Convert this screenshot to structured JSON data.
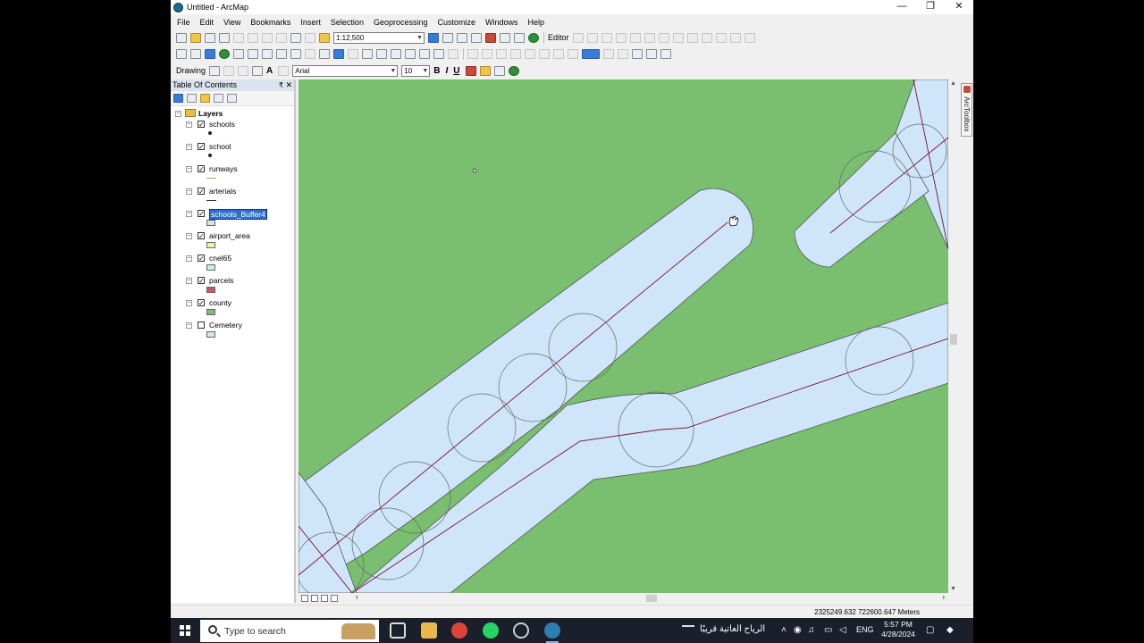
{
  "window": {
    "title": "Untitled - ArcMap",
    "minimize": "—",
    "maximize": "❐",
    "close": "✕"
  },
  "menu": [
    "File",
    "Edit",
    "View",
    "Bookmarks",
    "Insert",
    "Selection",
    "Geoprocessing",
    "Customize",
    "Windows",
    "Help"
  ],
  "toolbar": {
    "scale": "1:12,500",
    "editor_label": "Editor",
    "drawing_label": "Drawing",
    "font_name": "Arial",
    "font_size": "10",
    "bold": "B",
    "italic": "I",
    "underline": "U",
    "text_tool": "A"
  },
  "toc": {
    "title": "Table Of Contents",
    "pin": "₹",
    "close": "✕",
    "root_label": "Layers",
    "layers": [
      {
        "name": "schools",
        "checked": true,
        "symbol": "point",
        "color": "#222222"
      },
      {
        "name": "school",
        "checked": true,
        "symbol": "point",
        "color": "#222222"
      },
      {
        "name": "runways",
        "checked": true,
        "symbol": "line",
        "color": "#b8a060"
      },
      {
        "name": "arterials",
        "checked": true,
        "symbol": "line",
        "color": "#333333"
      },
      {
        "name": "schools_Buffer4",
        "checked": true,
        "symbol": "fill",
        "color": "#cfe6fa",
        "selected": true
      },
      {
        "name": "airport_area",
        "checked": true,
        "symbol": "fill",
        "color": "#f3f3a6"
      },
      {
        "name": "cnel65",
        "checked": true,
        "symbol": "fill",
        "color": "#cdeedd"
      },
      {
        "name": "parcels",
        "checked": true,
        "symbol": "fill",
        "color": "#c85a68"
      },
      {
        "name": "county",
        "checked": true,
        "symbol": "fill",
        "color": "#79bf6f"
      },
      {
        "name": "Cemetery",
        "checked": false,
        "symbol": "fill",
        "color": "#cdeedd"
      }
    ]
  },
  "map": {
    "background_color": "#79bf6f",
    "buffer_color": "#cfe6fa",
    "line_color": "#7a1030"
  },
  "arctoolbox_label": "ArcToolbox",
  "status": {
    "coordinates": "2325249.632  722600.647 Meters"
  },
  "taskbar": {
    "search_placeholder": "Type to search",
    "news": "الرياح العاتية قريبًا",
    "language": "ENG",
    "time": "5:57 PM",
    "date": "4/28/2024"
  }
}
